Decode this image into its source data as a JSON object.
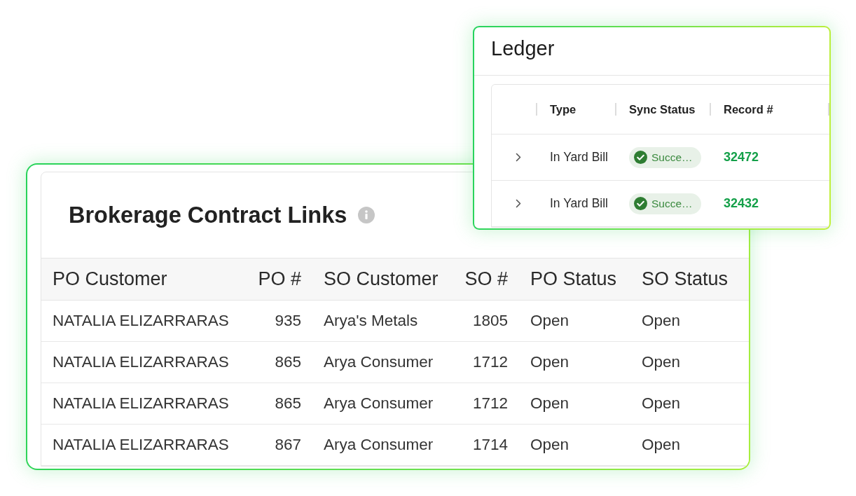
{
  "ledger": {
    "title": "Ledger",
    "columns": [
      "Type",
      "Sync Status",
      "Record #"
    ],
    "rows": [
      {
        "expanded": false,
        "type": "In Yard Bill",
        "sync_status": {
          "label": "Succe…",
          "kind": "success"
        },
        "record": "32472"
      },
      {
        "expanded": false,
        "type": "In Yard Bill",
        "sync_status": {
          "label": "Succe…",
          "kind": "success"
        },
        "record": "32432"
      }
    ]
  },
  "brokerage_contract_links": {
    "title": "Brokerage Contract Links",
    "columns": [
      "PO Customer",
      "PO #",
      "SO Customer",
      "SO #",
      "PO Status",
      "SO Status"
    ],
    "rows": [
      {
        "po_customer": "NATALIA ELIZARRARAS",
        "po_number": "935",
        "so_customer": "Arya's Metals",
        "so_number": "1805",
        "po_status": "Open",
        "so_status": "Open"
      },
      {
        "po_customer": "NATALIA ELIZARRARAS",
        "po_number": "865",
        "so_customer": "Arya Consumer",
        "so_number": "1712",
        "po_status": "Open",
        "so_status": "Open"
      },
      {
        "po_customer": "NATALIA ELIZARRARAS",
        "po_number": "865",
        "so_customer": "Arya Consumer",
        "so_number": "1712",
        "po_status": "Open",
        "so_status": "Open"
      },
      {
        "po_customer": "NATALIA ELIZARRARAS",
        "po_number": "867",
        "so_customer": "Arya Consumer",
        "so_number": "1714",
        "po_status": "Open",
        "so_status": "Open"
      }
    ]
  }
}
